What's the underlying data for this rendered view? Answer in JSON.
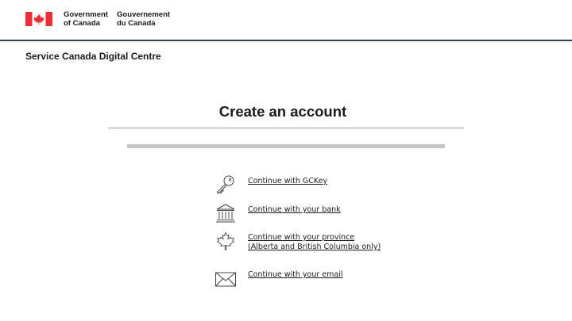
{
  "header": {
    "wordmark_en_line1": "Government",
    "wordmark_en_line2": "of Canada",
    "wordmark_fr_line1": "Gouvernement",
    "wordmark_fr_line2": "du Canada",
    "flag_icon": "canada-flag-icon",
    "flag_color": "#eb2d37"
  },
  "service_title": "Service Canada Digital Centre",
  "page_title": "Create an account",
  "progress": {
    "value": 0
  },
  "options": [
    {
      "label": "Continue with GCKey",
      "icon": "key-icon"
    },
    {
      "label": "Continue with your bank",
      "icon": "bank-icon"
    },
    {
      "label_line1": "Continue with your province",
      "label_line2": "(Alberta and British Columbia only)",
      "icon": "maple-leaf-icon"
    },
    {
      "label": "Continue with your email",
      "icon": "envelope-icon"
    }
  ]
}
